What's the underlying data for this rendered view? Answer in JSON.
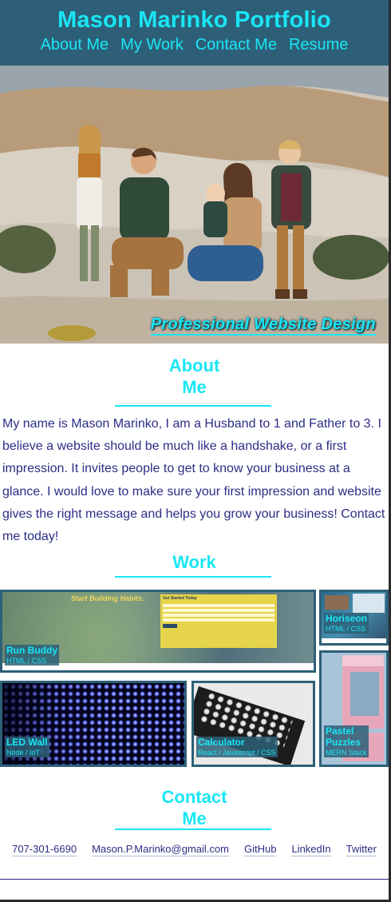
{
  "header": {
    "title": "Mason Marinko Portfolio",
    "nav": [
      "About Me",
      "My Work",
      "Contact Me",
      "Resume"
    ]
  },
  "hero": {
    "tagline": "Professional Website Design"
  },
  "about": {
    "title_line1": "About",
    "title_line2": "Me",
    "text": "My name is Mason Marinko, I am a Husband to 1 and Father to 3. I believe a website should be much like a handshake, or a first impression. It invites people to get to know your business at a glance. I would love to make sure your first impression and website gives the right message and helps you grow your business! Contact me today!"
  },
  "work": {
    "title": "Work",
    "projects": [
      {
        "name": "Run Buddy",
        "tech": "HTML / CSS",
        "headline": "Start Building Habits.",
        "form_title": "Get Started Today"
      },
      {
        "name": "Horiseon",
        "tech": "HTML / CSS"
      },
      {
        "name": "LED Wall",
        "tech": "Node / IoT"
      },
      {
        "name": "Calculator",
        "tech": "React / Javascript / CSS"
      },
      {
        "name": "Pastel Puzzles",
        "tech": "MERN Stack"
      }
    ]
  },
  "contact": {
    "title_line1": "Contact",
    "title_line2": "Me",
    "links": [
      "707-301-6690",
      "Mason.P.Marinko@gmail.com",
      "GitHub",
      "LinkedIn",
      "Twitter"
    ]
  },
  "colors": {
    "accent": "#19e6f5",
    "header_bg": "#2d6078",
    "body_text": "#2b2d85"
  }
}
